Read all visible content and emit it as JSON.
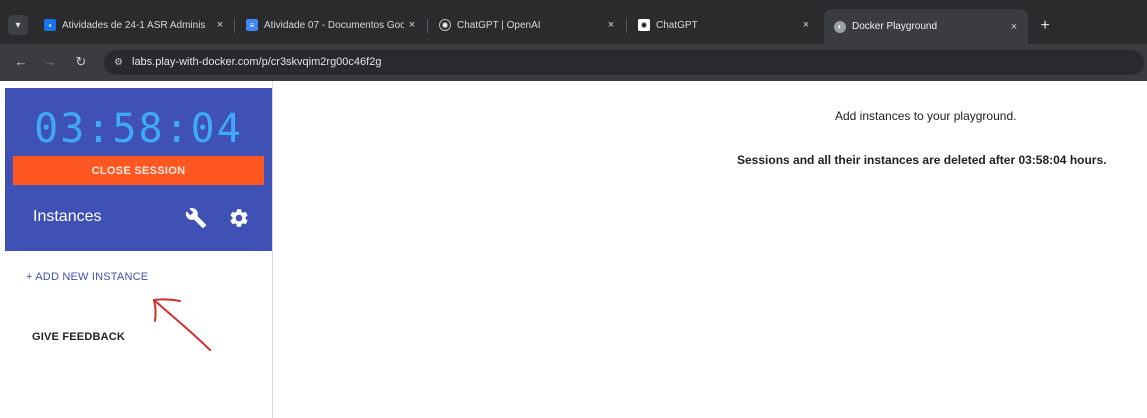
{
  "browser": {
    "tabs": [
      {
        "title": "Atividades de 24-1 ASR Adminis",
        "close": "×",
        "favicon_color": "#1a73e8"
      },
      {
        "title": "Atividade 07 - Documentos Goo",
        "close": "×",
        "favicon_color": "#4285f4"
      },
      {
        "title": "ChatGPT | OpenAI",
        "close": "×",
        "favicon_color": "#2b2b2e"
      },
      {
        "title": "ChatGPT",
        "close": "×",
        "favicon_color": "#ffffff"
      },
      {
        "title": "Docker Playground",
        "close": "×",
        "favicon_color": "#9aa0a6"
      }
    ],
    "active_tab": 4,
    "new_tab": "+",
    "url": "labs.play-with-docker.com/p/cr3skvqim2rg00c46f2g"
  },
  "sidebar": {
    "timer": "03:58:04",
    "close_session_label": "CLOSE SESSION",
    "instances_title": "Instances",
    "add_instance_label": "+ ADD NEW INSTANCE",
    "feedback_label": "GIVE FEEDBACK",
    "icons": [
      "wrench-icon",
      "gear-icon"
    ]
  },
  "main": {
    "line1": "Add instances to your playground.",
    "line2": "Sessions and all their instances are deleted after 03:58:04 hours."
  },
  "colors": {
    "header_bg": "#3f51b5",
    "timer": "#3fa9f5",
    "close_button": "#ff5722",
    "link": "#3f51b5",
    "annotation": "#d32f2f"
  }
}
